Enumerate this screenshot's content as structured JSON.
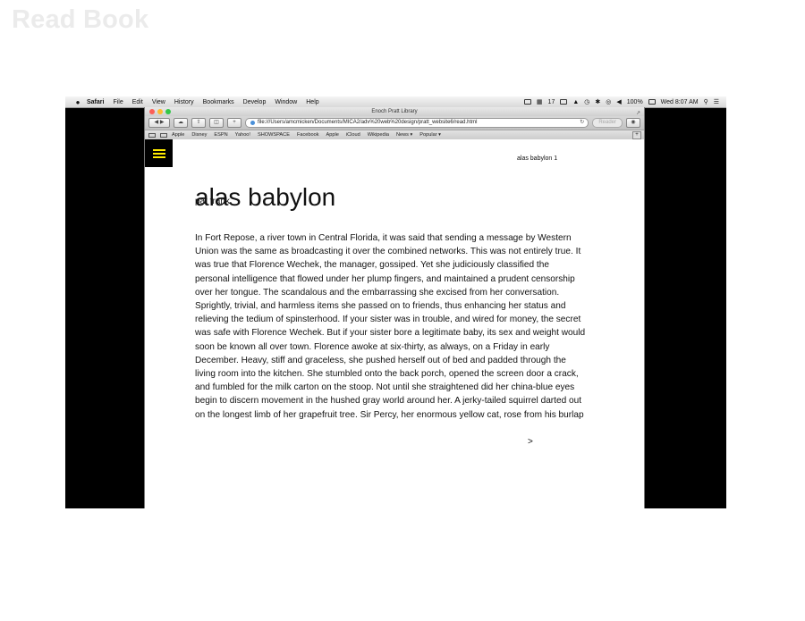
{
  "slide": {
    "title": "Read Book"
  },
  "menubar": {
    "items": [
      "Safari",
      "File",
      "Edit",
      "View",
      "History",
      "Bookmarks",
      "Develop",
      "Window",
      "Help"
    ],
    "status_count": "17",
    "battery": "100%",
    "clock": "Wed 8:07 AM"
  },
  "window": {
    "title": "Enoch Pratt Library",
    "url": "file:///Users/amcmicken/Documents/MICA2/adv%20web%20design/pratt_website6/read.html",
    "reader_label": "Reader",
    "bookmarks": [
      "Apple",
      "Disney",
      "ESPN",
      "Yahoo!",
      "SHOWSPACE",
      "Facebook",
      "Apple",
      "iCloud",
      "Wikipedia",
      "News ▾",
      "Popular ▾"
    ]
  },
  "page": {
    "header_right": "alas babylon 1",
    "title": "alas babylon",
    "author": "pat frank",
    "text_lines": [
      "In Fort Repose, a river town in Central Florida, it was said that sending a message by Western",
      "Union was the same as broadcasting it over the combined networks. This was not entirely true. It",
      "was true that Florence Wechek, the manager, gossiped. Yet she judiciously classified the",
      "personal intelligence that flowed under her plump fingers, and maintained a prudent censorship",
      "over her tongue. The scandalous and the embarrassing she excised from her conversation.",
      "Sprightly, trivial, and harmless items she passed on to friends, thus enhancing her status and",
      "relieving the tedium of spinsterhood. If your sister was in trouble, and wired for money, the secret",
      "was safe with Florence Wechek. But if your sister bore a legitimate baby, its sex and weight would",
      "soon be known all over town. Florence awoke at six-thirty, as always, on a Friday in early",
      "December. Heavy, stiff and graceless, she pushed herself out of bed and padded through the",
      "living room into the kitchen. She stumbled onto the back porch, opened the screen door a crack,",
      "and fumbled for the milk carton on the stoop. Not until she straightened did her china-blue eyes",
      "begin to discern movement in the hushed gray world around her. A jerky-tailed squirrel darted out",
      "on the longest limb of her grapefruit tree. Sir Percy, her enormous yellow cat, rose from his burlap"
    ],
    "next_label": ">"
  },
  "colors": {
    "accent": "#ffeb00",
    "frame": "#000000"
  }
}
